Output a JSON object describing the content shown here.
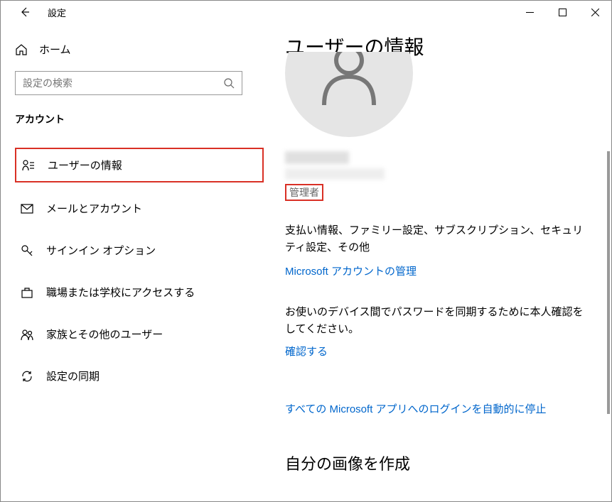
{
  "window": {
    "title": "設定"
  },
  "sidebar": {
    "home": "ホーム",
    "search_placeholder": "設定の検索",
    "section": "アカウント",
    "items": [
      {
        "label": "ユーザーの情報"
      },
      {
        "label": "メールとアカウント"
      },
      {
        "label": "サインイン オプション"
      },
      {
        "label": "職場または学校にアクセスする"
      },
      {
        "label": "家族とその他のユーザー"
      },
      {
        "label": "設定の同期"
      }
    ]
  },
  "content": {
    "page_title": "ユーザーの情報",
    "role": "管理者",
    "desc": "支払い情報、ファミリー設定、サブスクリプション、セキュリティ設定、その他",
    "manage_link": "Microsoft アカウントの管理",
    "verify_desc": "お使いのデバイス間でパスワードを同期するために本人確認をしてください。",
    "verify_link": "確認する",
    "stop_login_link": "すべての Microsoft アプリへのログインを自動的に停止",
    "create_image": "自分の画像を作成"
  }
}
